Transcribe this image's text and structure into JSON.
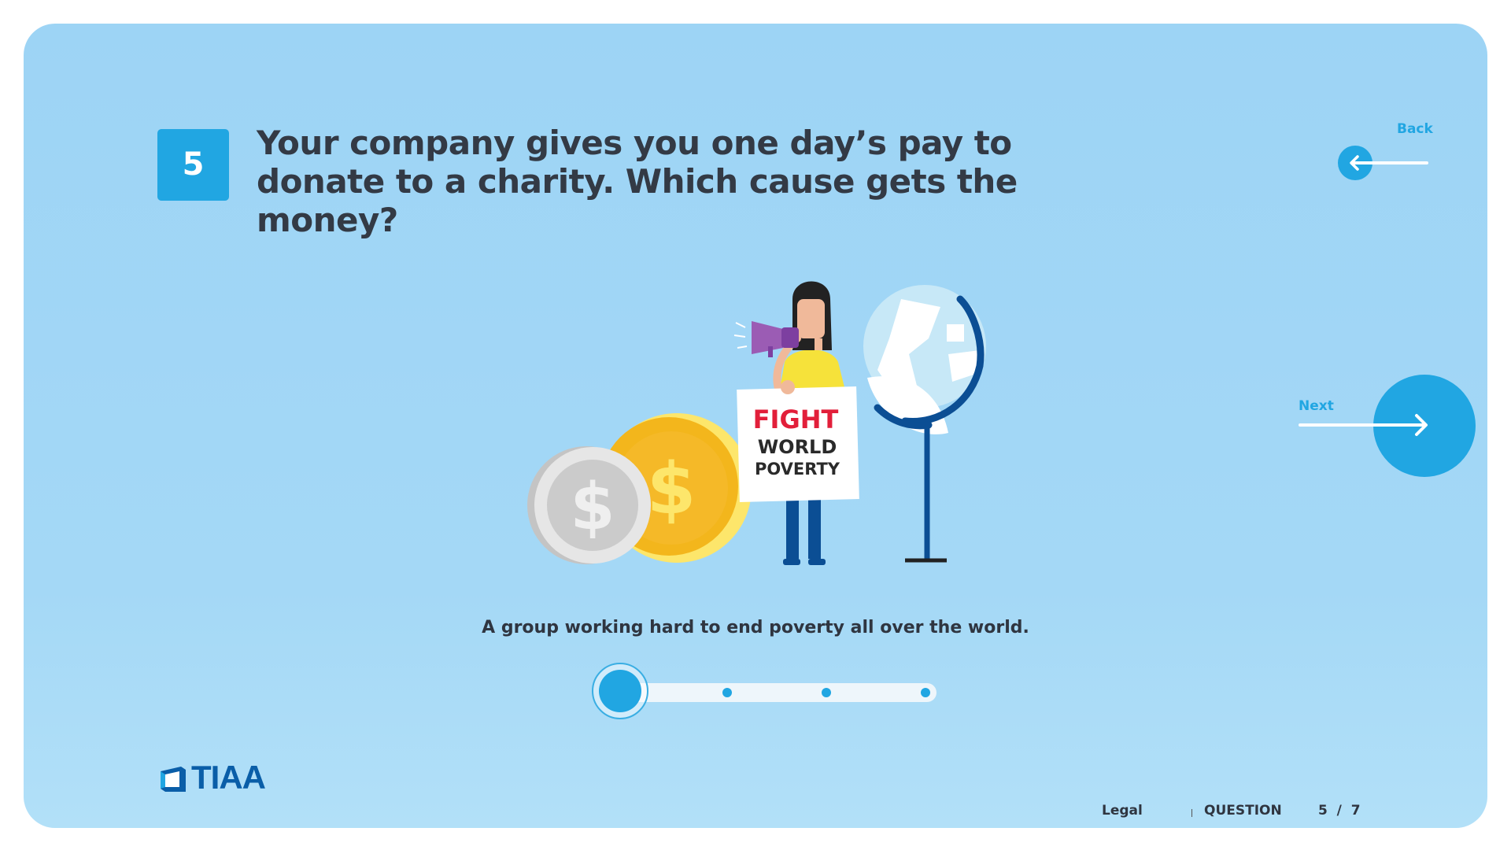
{
  "question": {
    "number": "5",
    "text": "Your company gives you one day’s pay to donate to a charity. Which cause gets the money?"
  },
  "nav": {
    "back_label": "Back",
    "next_label": "Next"
  },
  "illustration": {
    "sign_line1": "FIGHT",
    "sign_line2": "WORLD",
    "sign_line3": "POVERTY",
    "coin_symbol": "$"
  },
  "answer": {
    "caption": "A group working hard to end poverty all over the world.",
    "slider_stops": 4,
    "selected_index": 0
  },
  "footer": {
    "logo": "TIAA",
    "legal_label": "Legal",
    "question_label": "QUESTION",
    "progress": "5  /  7"
  },
  "colors": {
    "background": "#9dd4f5",
    "accent": "#21a6e2",
    "text": "#333a45",
    "brand": "#0a5ea8"
  }
}
